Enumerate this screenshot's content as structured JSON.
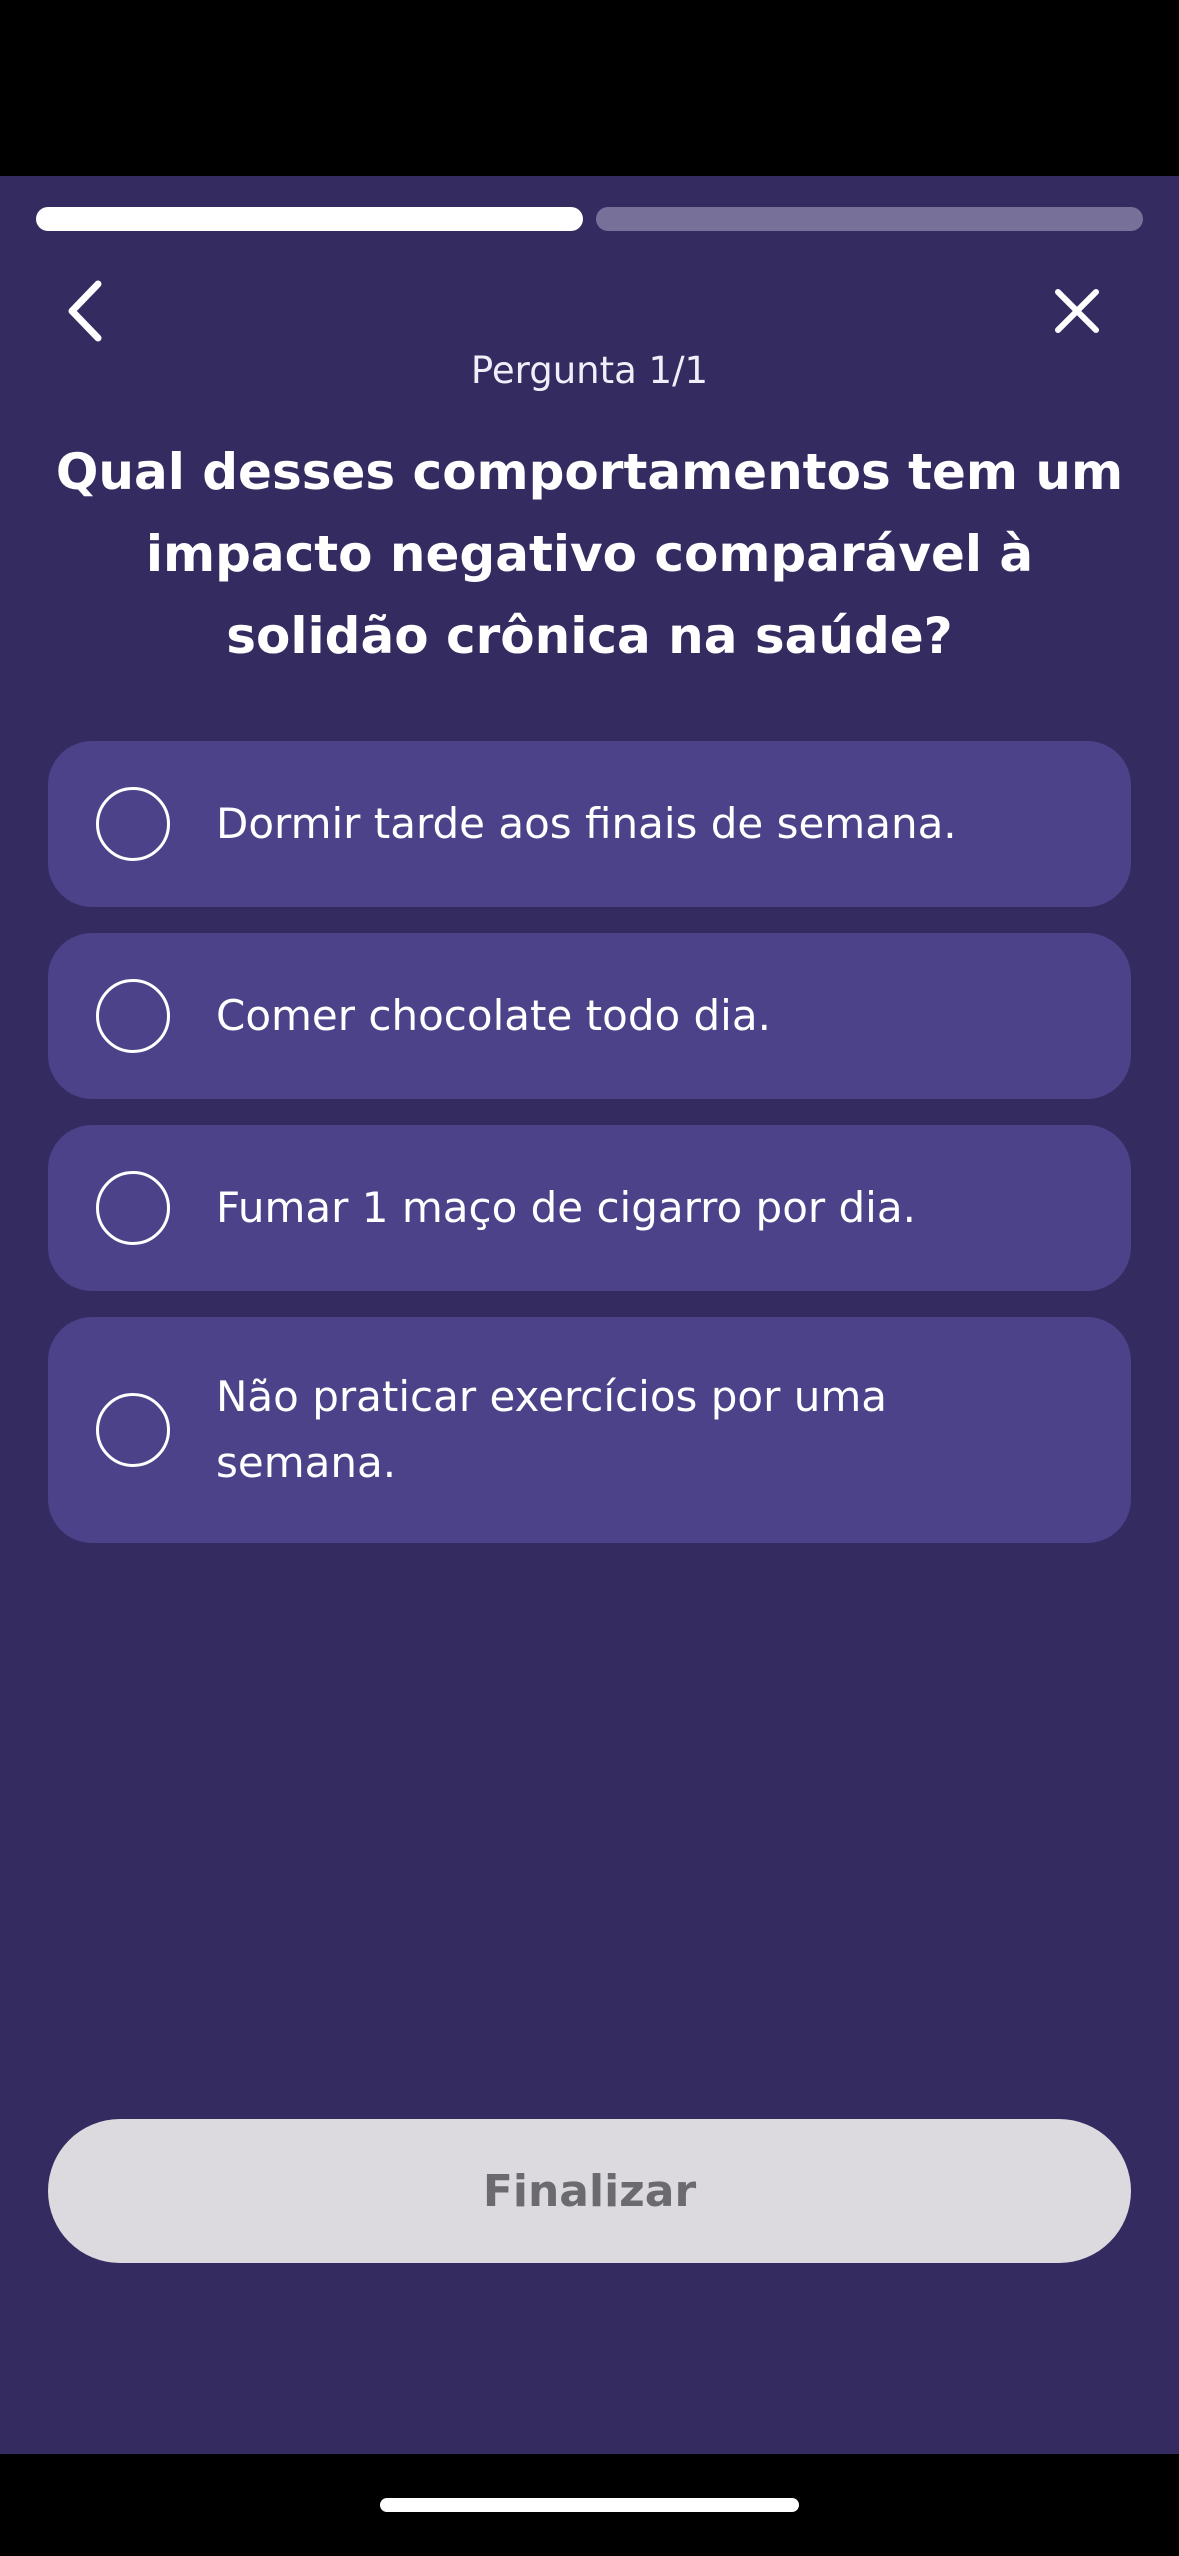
{
  "progress": {
    "steps_completed": 1,
    "steps_total": 2,
    "active_color": "#ffffff",
    "inactive_color": "#77719a"
  },
  "nav": {
    "back_icon": "chevron-left-icon",
    "close_icon": "close-icon"
  },
  "quiz": {
    "counter": "Pergunta 1/1",
    "question": "Qual desses comportamentos tem um impacto negativo comparável à solidão crônica na saúde?",
    "options": [
      {
        "label": "Dormir tarde aos finais de semana.",
        "selected": false
      },
      {
        "label": "Comer chocolate todo dia.",
        "selected": false
      },
      {
        "label": "Fumar 1 maço de cigarro por dia.",
        "selected": false
      },
      {
        "label": "Não praticar exercícios por uma semana.",
        "selected": false
      }
    ],
    "finish_label": "Finalizar"
  },
  "colors": {
    "background": "#342c61",
    "option_background": "#4b4289",
    "button_disabled": "#dcdadf",
    "button_text_disabled": "#6b6a6e"
  }
}
